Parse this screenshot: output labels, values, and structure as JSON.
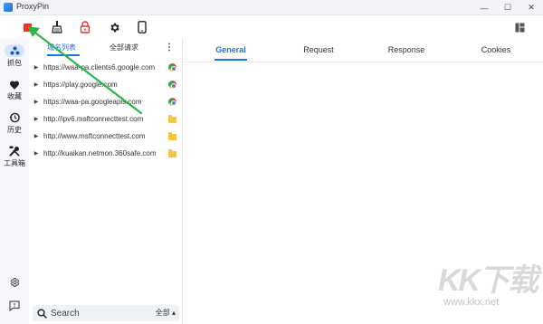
{
  "window": {
    "title": "ProxyPin",
    "controls": {
      "minimize": "—",
      "maximize": "☐",
      "close": "✕"
    }
  },
  "toolbar": {
    "buttons": [
      {
        "name": "stop-button",
        "icon": "stop-icon",
        "color": "#e8342c"
      },
      {
        "name": "clear-button",
        "icon": "broom-icon"
      },
      {
        "name": "ssl-button",
        "icon": "lock-icon",
        "color": "#e8342c"
      },
      {
        "name": "settings-button",
        "icon": "gear-icon"
      },
      {
        "name": "mobile-button",
        "icon": "phone-icon"
      }
    ],
    "layout_icon": "layout-icon"
  },
  "rail": {
    "items": [
      {
        "label": "抓包",
        "icon": "capture-icon",
        "active": true
      },
      {
        "label": "收藏",
        "icon": "heart-icon"
      },
      {
        "label": "历史",
        "icon": "history-icon"
      },
      {
        "label": "工具箱",
        "icon": "tools-icon"
      }
    ],
    "bottom": [
      {
        "icon": "gear-icon"
      },
      {
        "icon": "feedback-icon"
      }
    ]
  },
  "list": {
    "tabs": [
      {
        "label": "域名列表",
        "active": true
      },
      {
        "label": "全部请求",
        "active": false
      }
    ],
    "rows": [
      {
        "url": "https://waa-pa.clients6.google.com",
        "type": "chrome"
      },
      {
        "url": "https://play.google.com",
        "type": "chrome"
      },
      {
        "url": "https://waa-pa.googleapis.com",
        "type": "chrome"
      },
      {
        "url": "http://ipv6.msftconnecttest.com",
        "type": "folder"
      },
      {
        "url": "http://www.msftconnecttest.com",
        "type": "folder"
      },
      {
        "url": "http://kuaikan.netmon.360safe.com",
        "type": "folder"
      }
    ],
    "search": {
      "placeholder": "Search",
      "filter": "全部 ▴"
    }
  },
  "detail": {
    "tabs": [
      {
        "label": "General",
        "active": true
      },
      {
        "label": "Request",
        "active": false
      },
      {
        "label": "Response",
        "active": false
      },
      {
        "label": "Cookies",
        "active": false
      }
    ]
  },
  "watermark": {
    "logo": "KK下载",
    "url": "www.kkx.net"
  },
  "colors": {
    "accent": "#1a73e8",
    "annotation": "#2eb34a",
    "stop": "#e8342c"
  }
}
